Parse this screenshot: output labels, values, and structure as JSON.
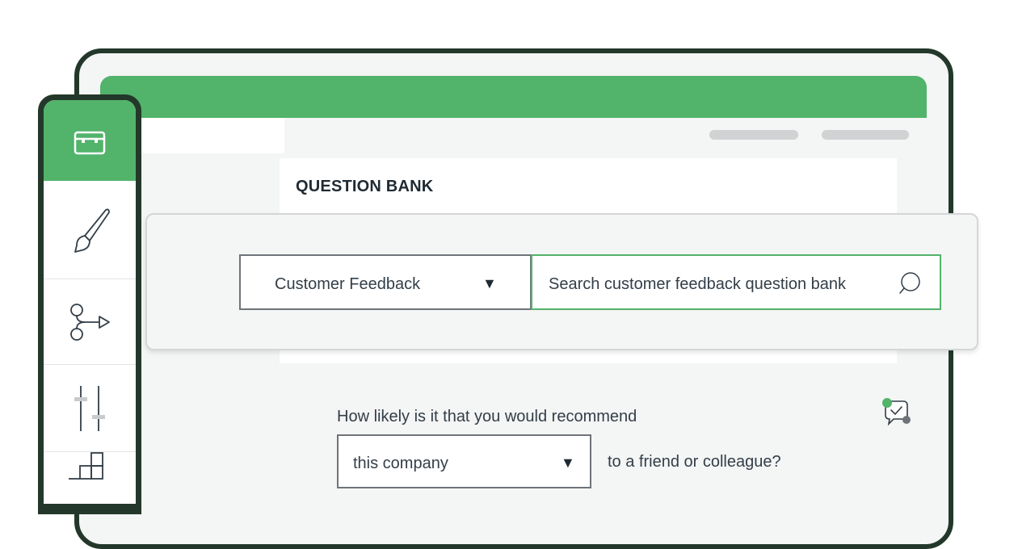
{
  "question_bank": {
    "title": "QUESTION BANK",
    "category_select": {
      "value": "Customer Feedback",
      "caret": "▼"
    },
    "search": {
      "placeholder": "Search customer feedback question bank"
    }
  },
  "question": {
    "text": "How likely is it that you would recommend",
    "subject_select": {
      "value": "this company",
      "caret": "▼"
    },
    "suffix": "to a friend or colleague?"
  },
  "sidebar": {
    "items": [
      {
        "icon": "toolbox-icon",
        "active": true
      },
      {
        "icon": "paintbrush-icon",
        "active": false
      },
      {
        "icon": "logic-branch-icon",
        "active": false
      },
      {
        "icon": "sliders-icon",
        "active": false
      },
      {
        "icon": "blocks-icon",
        "active": false
      }
    ]
  },
  "colors": {
    "accent": "#52b36a",
    "dark_frame": "#23382a",
    "background": "#f4f5f5",
    "border": "#6f7479"
  }
}
